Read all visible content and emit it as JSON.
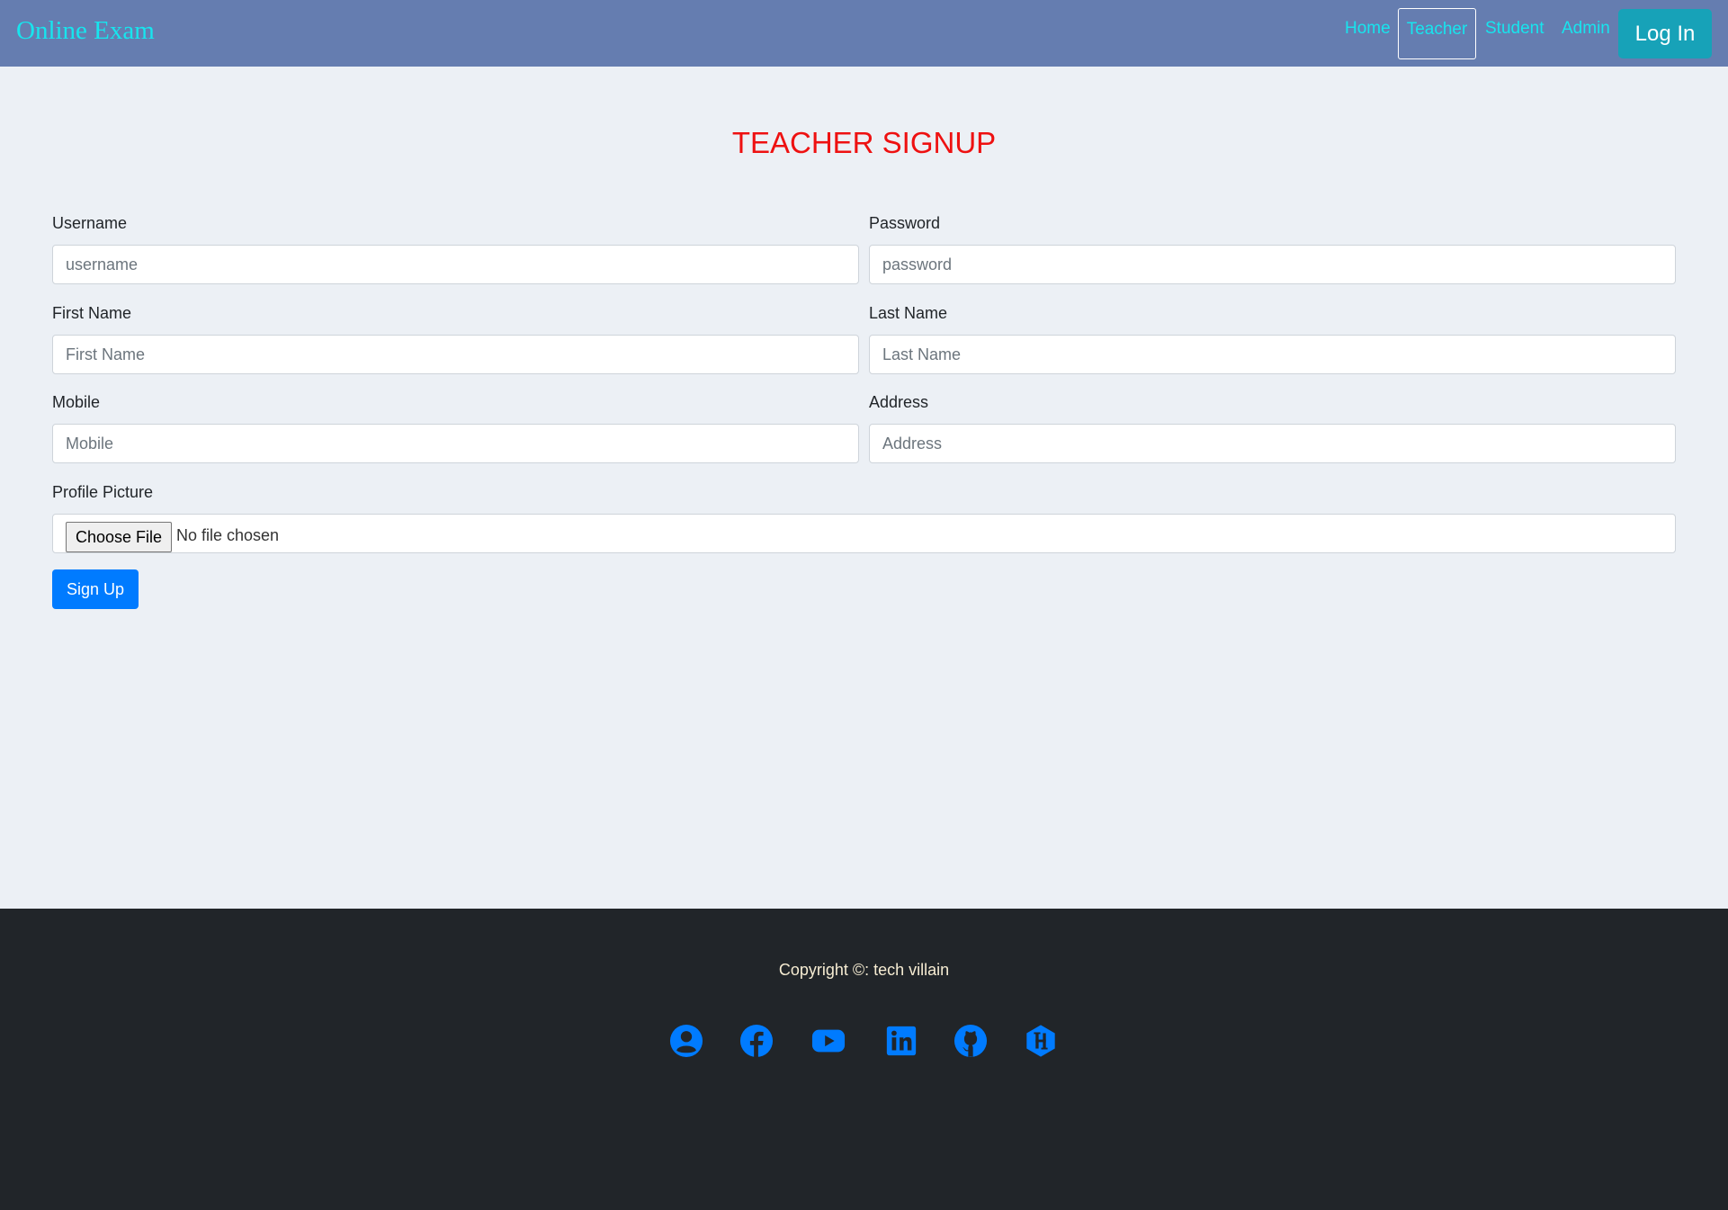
{
  "navbar": {
    "brand": "Online Exam",
    "links": [
      "Home",
      "Teacher",
      "Student",
      "Admin"
    ],
    "active_link": "Teacher",
    "login_label": "Log In"
  },
  "page": {
    "title": "TEACHER SIGNUP"
  },
  "form": {
    "username": {
      "label": "Username",
      "placeholder": "username",
      "value": ""
    },
    "password": {
      "label": "Password",
      "placeholder": "password",
      "value": ""
    },
    "first_name": {
      "label": "First Name",
      "placeholder": "First Name",
      "value": ""
    },
    "last_name": {
      "label": "Last Name",
      "placeholder": "Last Name",
      "value": ""
    },
    "mobile": {
      "label": "Mobile",
      "placeholder": "Mobile",
      "value": ""
    },
    "address": {
      "label": "Address",
      "placeholder": "Address",
      "value": ""
    },
    "profile_picture": {
      "label": "Profile Picture",
      "button_label": "Choose File",
      "status": "No file chosen"
    },
    "submit_label": "Sign Up"
  },
  "footer": {
    "copyright": "Copyright ©: tech villain",
    "social_icons": [
      "user-circle-icon",
      "facebook-icon",
      "youtube-icon",
      "linkedin-icon",
      "github-icon",
      "hackerrank-icon"
    ]
  },
  "colors": {
    "navbar_bg": "#657db0",
    "nav_link": "#17e5ee",
    "login_button": "#17a2b8",
    "title": "#ee1111",
    "page_bg": "#ecf0f5",
    "primary_button": "#007bff",
    "footer_bg": "#212529",
    "footer_text": "#f6ecd2",
    "social_icon": "#007bff"
  }
}
